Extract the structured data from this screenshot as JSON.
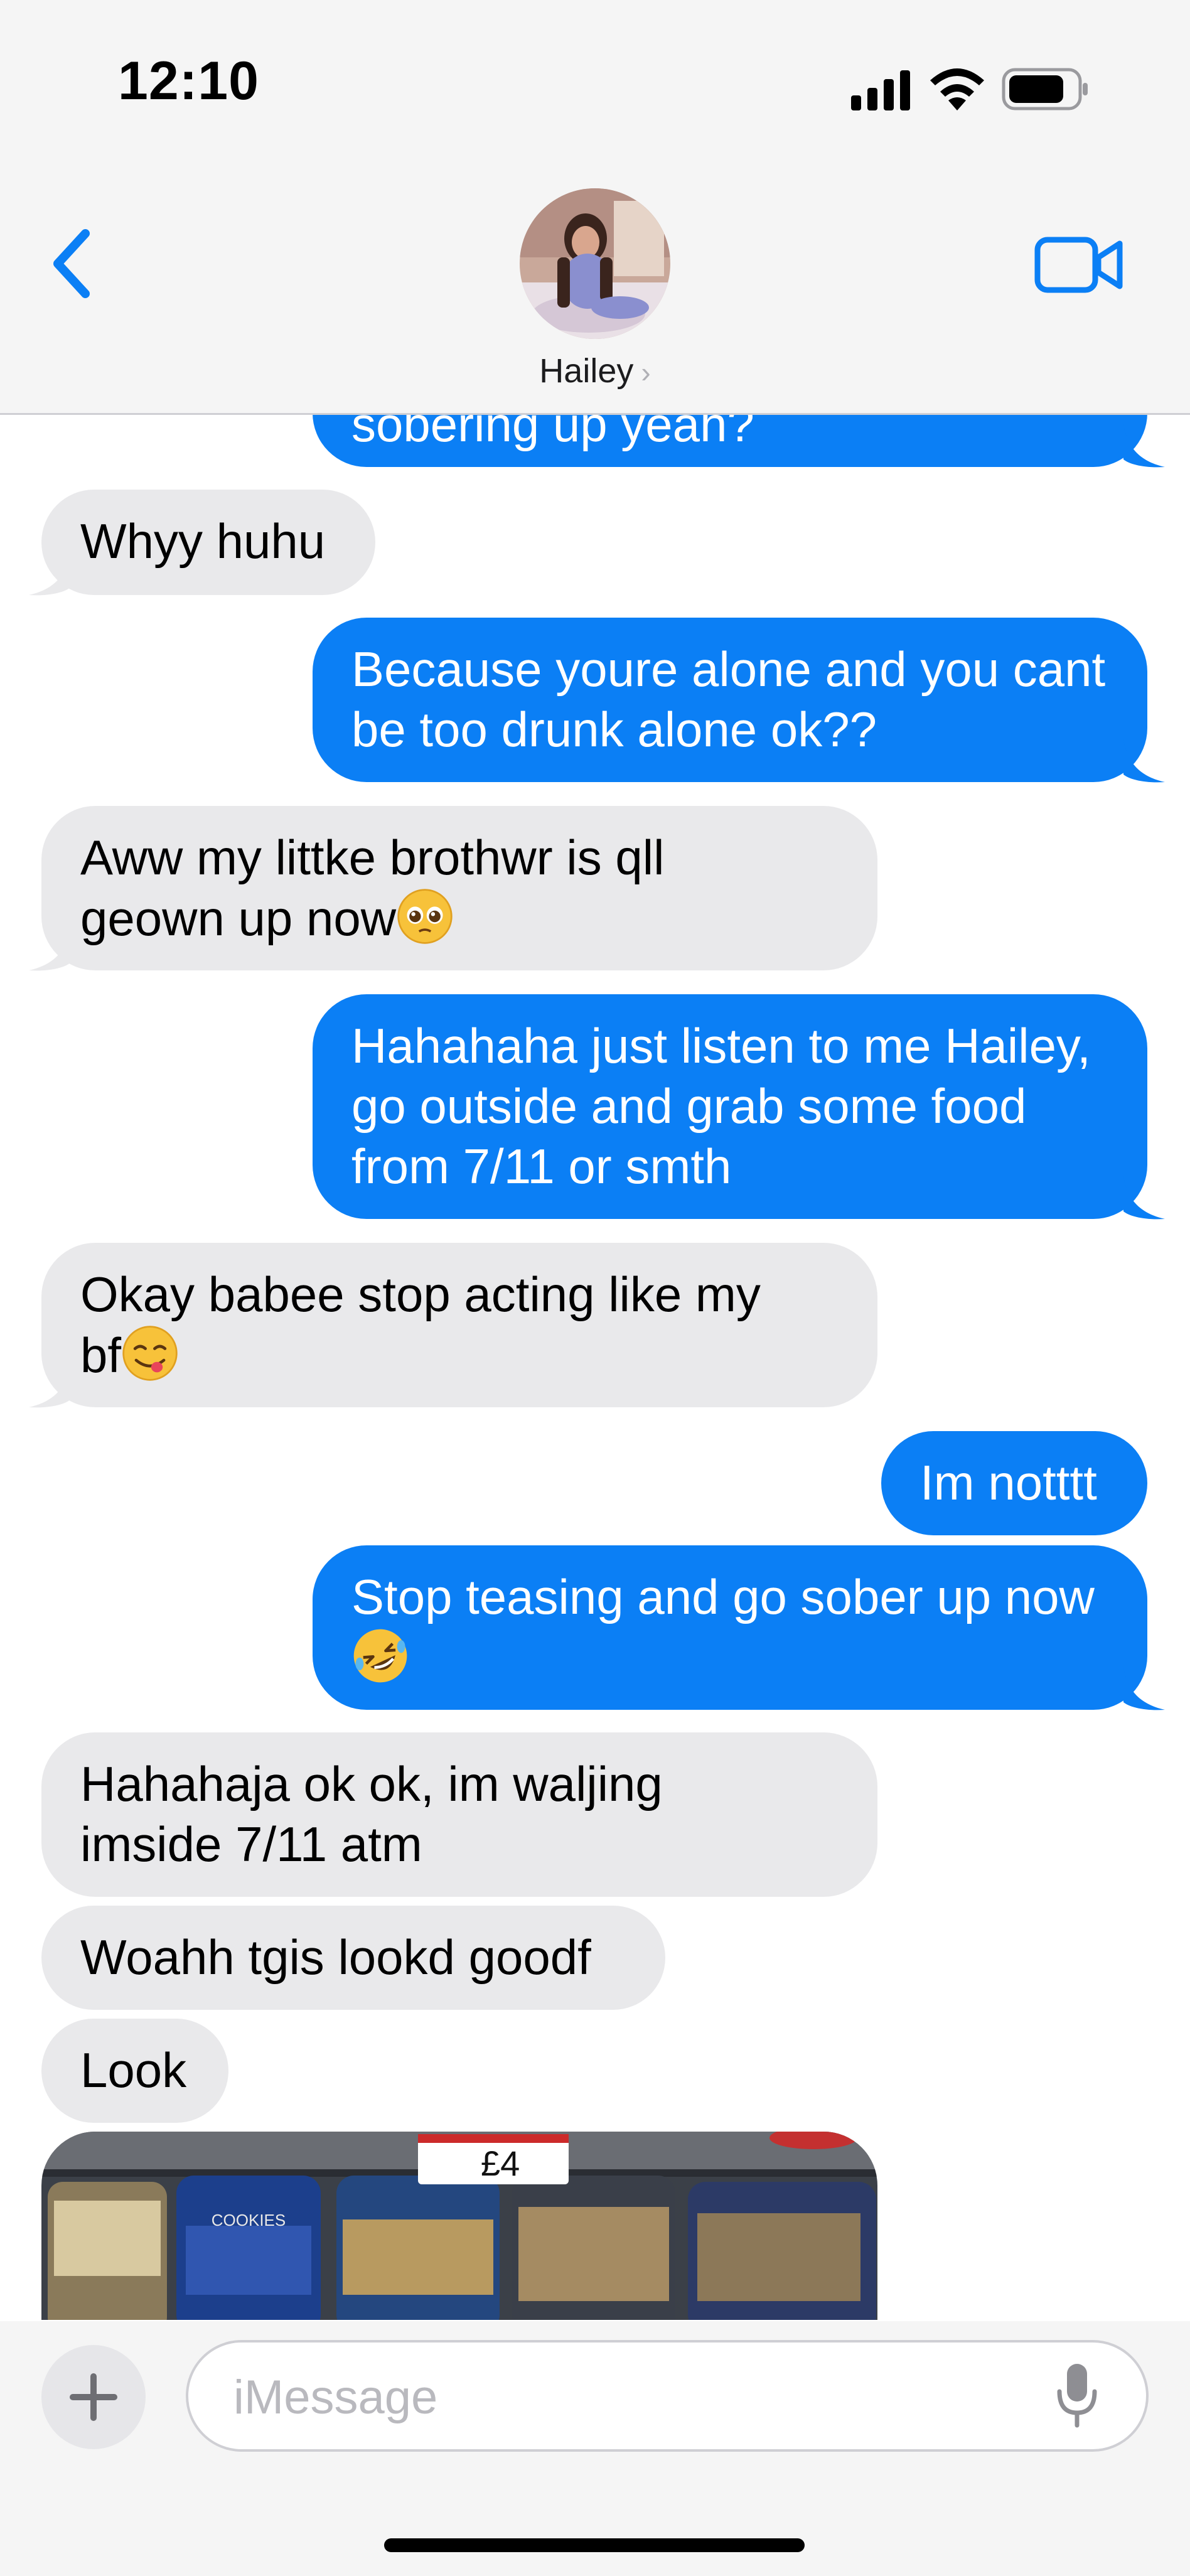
{
  "status_bar": {
    "time": "12:10"
  },
  "header": {
    "contact_name": "Hailey",
    "chevron": "›",
    "icons": [
      "back-chevron-icon",
      "video-call-icon"
    ],
    "accent_color": "#0b7ff5"
  },
  "messages": [
    {
      "id": "m0",
      "side": "outgoing",
      "text": "sobering up yeah?",
      "partially_visible": true
    },
    {
      "id": "m1",
      "side": "incoming",
      "text": "Whyy huhu"
    },
    {
      "id": "m2",
      "side": "outgoing",
      "text": "Because youre alone and you cant be too drunk alone ok??"
    },
    {
      "id": "m3",
      "side": "incoming",
      "text": "Aww my littke brothwr is qll geown up now",
      "emoji": "pleading-face-emoji"
    },
    {
      "id": "m4",
      "side": "outgoing",
      "text": "Hahahaha just listen to me Hailey, go outside and grab some food from 7/11  or smth"
    },
    {
      "id": "m5",
      "side": "incoming",
      "text": "Okay babee stop acting like my bf",
      "emoji": "yum-face-emoji"
    },
    {
      "id": "m6",
      "side": "outgoing",
      "text": "Im notttt"
    },
    {
      "id": "m7",
      "side": "outgoing",
      "text": "Stop teasing and go sober up now",
      "emoji": "rofl-face-emoji"
    },
    {
      "id": "m8",
      "side": "incoming",
      "text": "Hahahaja ok ok, im waljing imside 7/11 atm"
    },
    {
      "id": "m9",
      "side": "incoming",
      "text": "Woahh tgis lookd goodf"
    },
    {
      "id": "m10",
      "side": "incoming",
      "text": "Look"
    }
  ],
  "photo": {
    "price_tag": "£4",
    "label": "COOKIES"
  },
  "composer": {
    "plus_label": "+",
    "placeholder": "iMessage",
    "icons": [
      "plus-icon",
      "microphone-icon"
    ]
  },
  "colors": {
    "incoming_bubble": "#e9e9eb",
    "outgoing_bubble": "#0b7ff5",
    "header_bg": "#f5f5f5"
  }
}
